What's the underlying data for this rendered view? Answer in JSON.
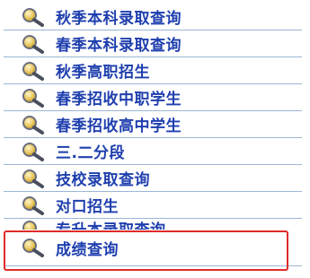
{
  "menu": {
    "items": [
      {
        "label": "秋季本科录取查询",
        "icon": "magnifier-icon"
      },
      {
        "label": "春季本科录取查询",
        "icon": "magnifier-icon"
      },
      {
        "label": "秋季高职招生",
        "icon": "magnifier-icon"
      },
      {
        "label": "春季招收中职学生",
        "icon": "magnifier-icon"
      },
      {
        "label": "春季招收高中学生",
        "icon": "magnifier-icon"
      },
      {
        "label": "三.二分段",
        "icon": "magnifier-icon"
      },
      {
        "label": "技校录取查询",
        "icon": "magnifier-icon"
      },
      {
        "label": "对口招生",
        "icon": "magnifier-icon"
      },
      {
        "label": "专升本录取查询",
        "icon": "magnifier-icon"
      },
      {
        "label": "成绩查询",
        "icon": "magnifier-icon",
        "highlighted": true
      }
    ]
  },
  "colors": {
    "label_text": "#1f3fae",
    "divider": "#9bb7d6",
    "highlight_border": "#e02a2a",
    "icon_lens": "#c9a227"
  }
}
